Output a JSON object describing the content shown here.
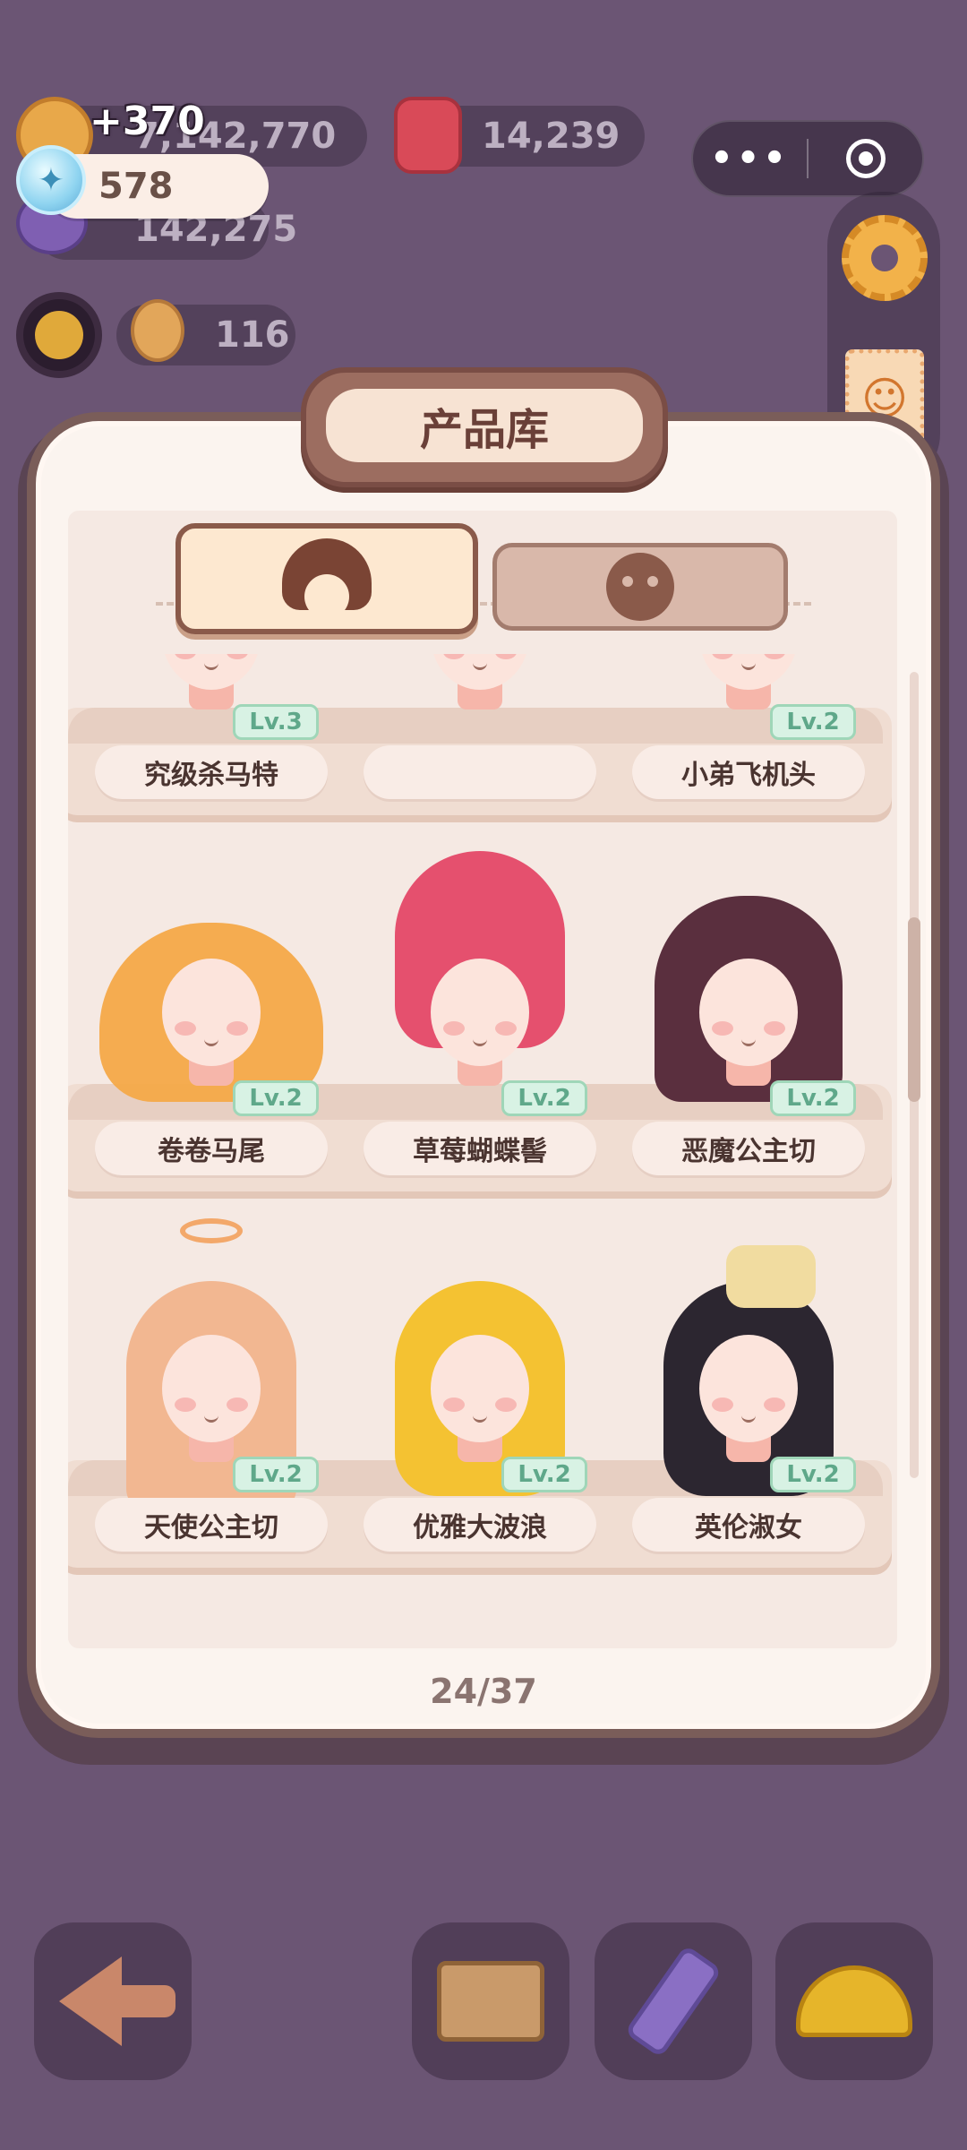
{
  "colors": {
    "background": "#6b5574",
    "panel": "#fbf4ef",
    "plaque": "#9c6d60",
    "level_badge": "#d8f2e4",
    "level_text": "#5fa88a"
  },
  "resources": {
    "coins": "7,142,770",
    "berry": "14,239",
    "gems": "142,275",
    "cookies": "116",
    "energy": "578",
    "float_gain": "+370"
  },
  "panel": {
    "title": "产品库",
    "tabs": [
      {
        "name": "hair",
        "icon": "hair-icon",
        "active": true
      },
      {
        "name": "face",
        "icon": "face-icon",
        "active": false
      }
    ],
    "page_counter": "24/37"
  },
  "shelves": [
    {
      "items": [
        {
          "name": "究级杀马特",
          "level": "Lv.3",
          "hair_color": "#6a4a7a",
          "hair": "spiky"
        },
        {
          "name": "",
          "level": "",
          "hair_color": "",
          "hair": "none"
        },
        {
          "name": "小弟飞机头",
          "level": "Lv.2",
          "hair_color": "#3a3658",
          "hair": "short"
        }
      ]
    },
    {
      "items": [
        {
          "name": "卷卷马尾",
          "level": "Lv.2",
          "hair_color": "#f4a948",
          "hair": "twin-curls"
        },
        {
          "name": "草莓蝴蝶髻",
          "level": "Lv.2",
          "hair_color": "#e5506e",
          "hair": "bun"
        },
        {
          "name": "恶魔公主切",
          "level": "Lv.2",
          "hair_color": "#5a2f3e",
          "hair": "hime"
        }
      ]
    },
    {
      "items": [
        {
          "name": "天使公主切",
          "level": "Lv.2",
          "hair_color": "#f2b791",
          "hair": "halo"
        },
        {
          "name": "优雅大波浪",
          "level": "Lv.2",
          "hair_color": "#f4c232",
          "hair": "waves"
        },
        {
          "name": "英伦淑女",
          "level": "Lv.2",
          "hair_color": "#2c2630",
          "hair": "veil"
        }
      ]
    }
  ],
  "bottom_bar": [
    {
      "icon": "back-arrow-icon"
    },
    {
      "icon": "storage-box-icon"
    },
    {
      "icon": "pencil-ruler-icon"
    },
    {
      "icon": "hard-hat-icon"
    }
  ]
}
